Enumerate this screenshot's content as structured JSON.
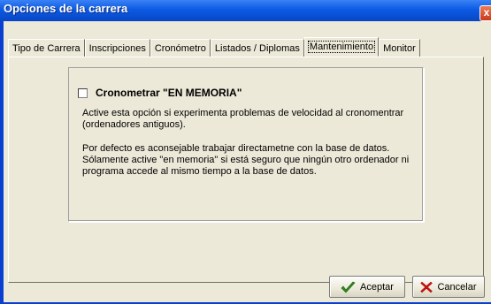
{
  "window": {
    "title": "Opciones de la carrera",
    "close_label": "x"
  },
  "tabs": [
    {
      "label": "Tipo de Carrera",
      "active": false
    },
    {
      "label": "Inscripciones",
      "active": false
    },
    {
      "label": "Cronómetro",
      "active": false
    },
    {
      "label": "Listados / Diplomas",
      "active": false
    },
    {
      "label": "Mantenimiento",
      "active": true
    },
    {
      "label": "Monitor",
      "active": false
    }
  ],
  "option": {
    "checkbox_label": "Cronometrar \"EN MEMORIA\"",
    "checked": false,
    "paragraph1": "Active esta opción si experimenta problemas de velocidad al cronomentrar (ordenadores antiguos).",
    "paragraph2": "Por defecto es aconsejable trabajar directametne con la base de datos. Sólamente active \"en memoria\" si está seguro que ningún otro ordenador ni programa accede al mismo tiempo a la base de datos."
  },
  "buttons": {
    "ok_label": "Aceptar",
    "cancel_label": "Cancelar"
  },
  "icons": {
    "ok": "checkmark-icon",
    "cancel": "x-icon"
  },
  "colors": {
    "titlebar": "#0c5ae4",
    "dialog_bg": "#ece9d8",
    "ok_icon": "#2e8b1f",
    "cancel_icon": "#d01010"
  }
}
